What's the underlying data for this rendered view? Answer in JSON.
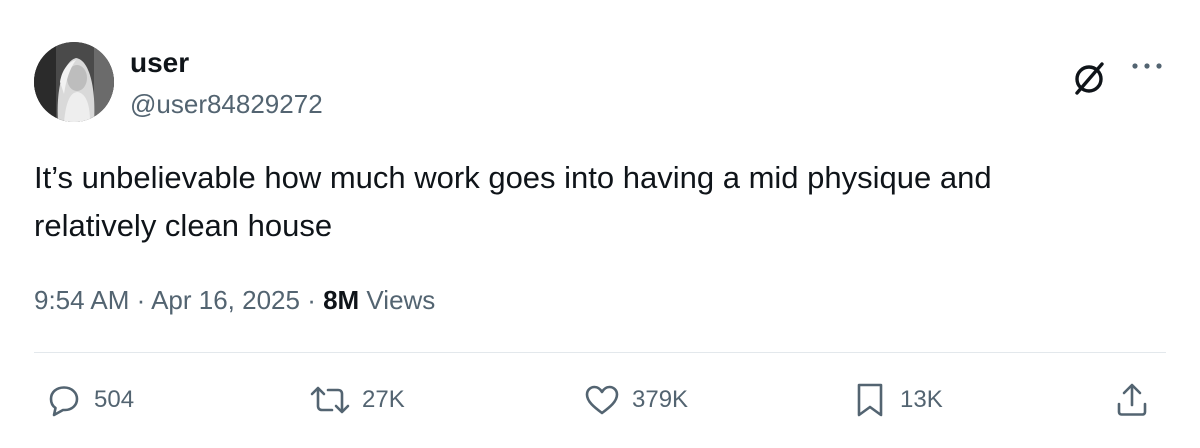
{
  "author": {
    "display_name": "user",
    "handle": "@user84829272",
    "avatar": "avatar-statue-image"
  },
  "icons": {
    "grok": "grok-icon",
    "more": "more-icon",
    "reply": "reply-icon",
    "repost": "repost-icon",
    "like": "like-icon",
    "bookmark": "bookmark-icon",
    "share": "share-icon"
  },
  "tweet": {
    "text_lines": [
      "It’s unbelievable how much work goes into having a mid physique and",
      "relatively clean house"
    ]
  },
  "meta": {
    "time": "9:54 AM",
    "separator": " · ",
    "date": "Apr 16, 2025",
    "views_count": "8M",
    "views_label": " Views"
  },
  "actions": {
    "replies": "504",
    "reposts": "27K",
    "likes": "379K",
    "bookmarks": "13K"
  },
  "colors": {
    "text_primary": "#0f1419",
    "text_secondary": "#536471",
    "divider": "#e3e8ec"
  }
}
